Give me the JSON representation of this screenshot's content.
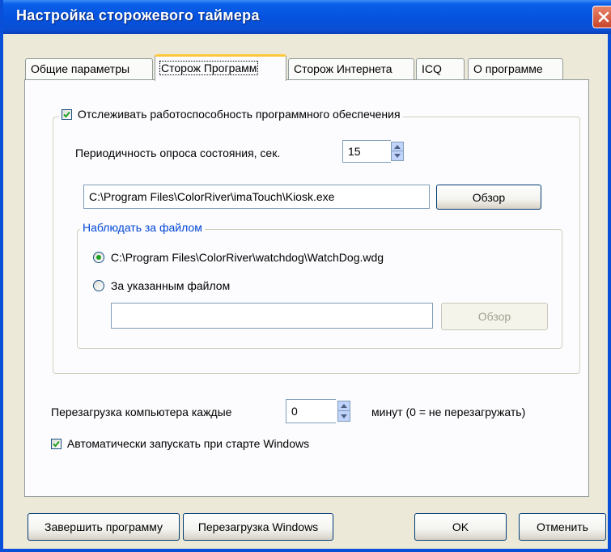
{
  "window": {
    "title": "Настройка сторожевого таймера"
  },
  "tabs": [
    {
      "label": "Общие параметры"
    },
    {
      "label": "Сторож Программ"
    },
    {
      "label": "Сторож Интернета"
    },
    {
      "label": "ICQ"
    },
    {
      "label": "О программе"
    }
  ],
  "active_tab": "Сторож Программ",
  "monitor": {
    "checkbox_label": "Отслеживать работоспособность программного обеспечения",
    "checked": true,
    "interval_label": "Периодичность опроса состояния, сек.",
    "interval_value": "15",
    "program_path": "C:\\Program Files\\ColorRiver\\imaTouch\\Kiosk.exe",
    "browse_label": "Обзор"
  },
  "watch_file": {
    "legend": "Наблюдать за файлом",
    "option_default": "C:\\Program Files\\ColorRiver\\watchdog\\WatchDog.wdg",
    "option_custom": "За указанным файлом",
    "selected": "default",
    "custom_path": "",
    "browse_label": "Обзор"
  },
  "reboot": {
    "label": "Перезагрузка компьютера каждые",
    "value": "0",
    "suffix": "минут  (0 = не перезагружать)"
  },
  "autostart": {
    "label": "Автоматически запускать при старте Windows",
    "checked": true
  },
  "buttons": {
    "exit": "Завершить программу",
    "restart_windows": "Перезагрузка Windows",
    "ok": "OK",
    "cancel": "Отменить"
  },
  "colors": {
    "titlebar": "#0553df",
    "face": "#ece9d8",
    "accent_tab": "#ffc83c",
    "legend_text": "#0046d5"
  }
}
